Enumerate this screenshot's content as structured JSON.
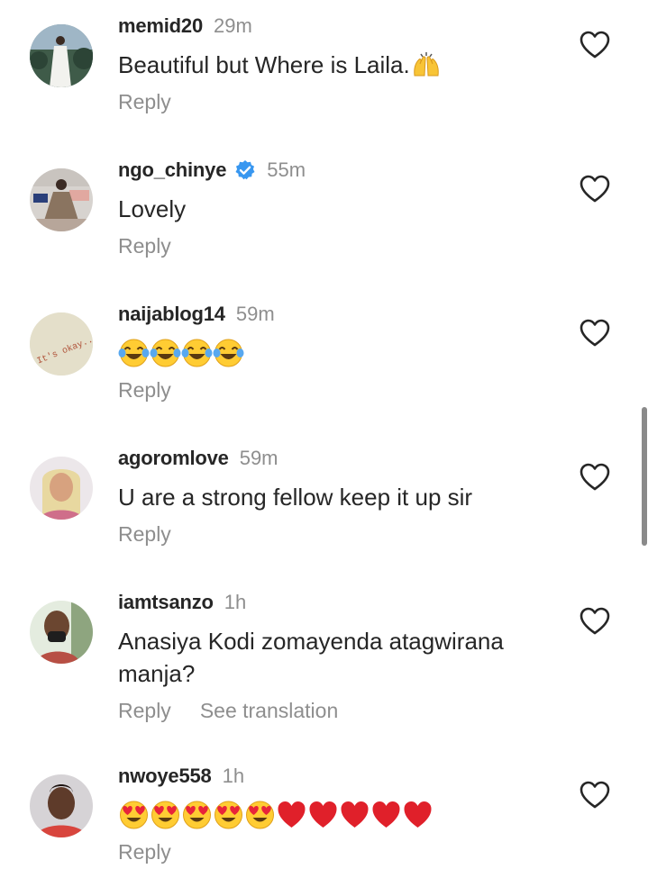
{
  "comments": [
    {
      "username": "memid20",
      "time": "29m",
      "text": "Beautiful but Where is Laila.",
      "reply": "Reply",
      "verified": false,
      "avatar": "avatar-photo-woman-white-dress"
    },
    {
      "username": "ngo_chinye",
      "time": "55m",
      "text": "Lovely",
      "reply": "Reply",
      "verified": true,
      "avatar": "avatar-photo-seated-woman"
    },
    {
      "username": "naijablog14",
      "time": "59m",
      "text": "",
      "emoji": [
        "joy",
        "joy",
        "joy",
        "joy"
      ],
      "reply": "Reply",
      "verified": false,
      "avatar": "avatar-photo-its-okay-text",
      "avatar_text": "It's okay.."
    },
    {
      "username": "agoromlove",
      "time": "59m",
      "text": "U are a strong fellow keep it up sir",
      "reply": "Reply",
      "verified": false,
      "avatar": "avatar-photo-woman-blonde"
    },
    {
      "username": "iamtsanzo",
      "time": "1h",
      "text_line1": "Anasiya Kodi zomayenda atagwirana",
      "text_line2": "manja?",
      "reply": "Reply",
      "translate": "See translation",
      "verified": false,
      "avatar": "avatar-photo-woman-mask"
    },
    {
      "username": "nwoye558",
      "time": "1h",
      "text": "",
      "emoji": [
        "heart-eyes",
        "heart-eyes",
        "heart-eyes",
        "heart-eyes",
        "heart-eyes",
        "red-heart",
        "red-heart",
        "red-heart",
        "red-heart",
        "red-heart"
      ],
      "reply": "Reply",
      "verified": false,
      "avatar": "avatar-photo-woman-red-top"
    }
  ],
  "icons": {
    "like": "heart-outline-icon",
    "verified": "verified-badge-icon",
    "hands": "raising-hands-emoji"
  },
  "colors": {
    "text": "#262626",
    "muted": "#8e8e8e",
    "verified": "#3897f0",
    "heart": "#e0202a",
    "emoji_face": "#ffcc33"
  }
}
